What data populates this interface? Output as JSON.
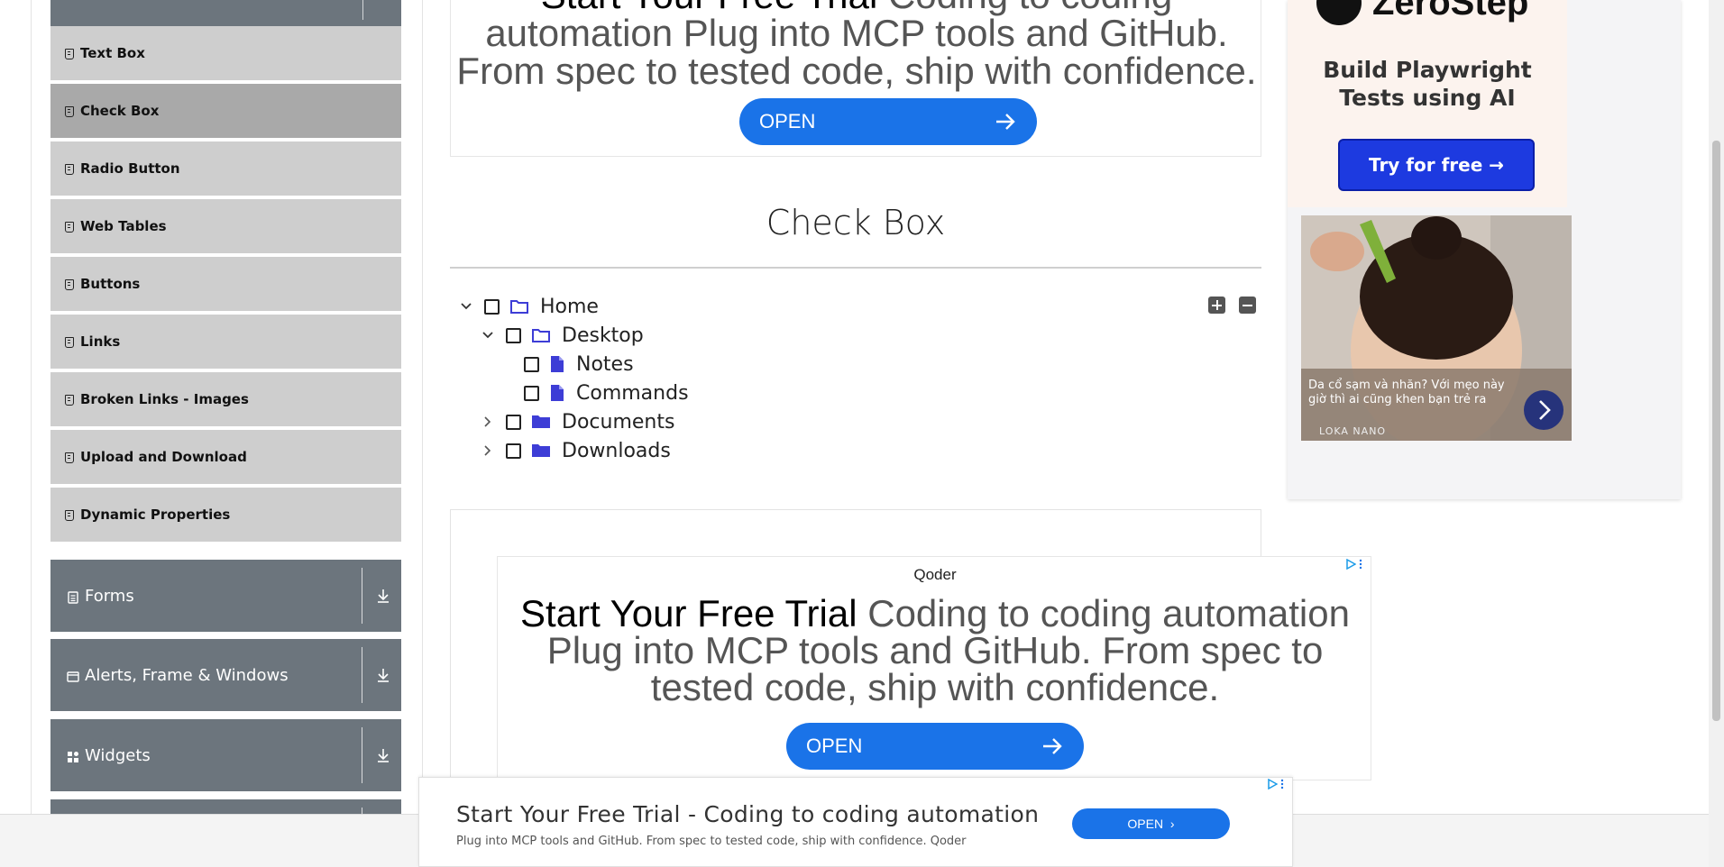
{
  "sidebar": {
    "elements_items": [
      {
        "label": "Text Box"
      },
      {
        "label": "Check Box"
      },
      {
        "label": "Radio Button"
      },
      {
        "label": "Web Tables"
      },
      {
        "label": "Buttons"
      },
      {
        "label": "Links"
      },
      {
        "label": "Broken Links - Images"
      },
      {
        "label": "Upload and Download"
      },
      {
        "label": "Dynamic Properties"
      }
    ],
    "active_item": "Check Box",
    "groups": [
      {
        "label": "Forms",
        "icon": "form-icon"
      },
      {
        "label": "Alerts, Frame & Windows",
        "icon": "window-icon"
      },
      {
        "label": "Widgets",
        "icon": "widgets-icon"
      }
    ]
  },
  "ad_top": {
    "headline_bold": "Start Your Free Trial",
    "headline_rest": " Coding to coding automation Plug into MCP tools and GitHub. From spec to tested code, ship with confidence.",
    "button_label": "OPEN"
  },
  "main": {
    "title": "Check Box",
    "tree": {
      "home": "Home",
      "desktop": "Desktop",
      "notes": "Notes",
      "commands": "Commands",
      "documents": "Documents",
      "downloads": "Downloads"
    }
  },
  "ad_mid": {
    "brand": "Qoder",
    "headline_bold": "Start Your Free Trial",
    "headline_rest": " Coding to coding automation Plug into MCP tools and GitHub. From spec to tested code, ship with confidence.",
    "button_label": "OPEN"
  },
  "ad_bottom": {
    "title": "Start Your Free Trial - Coding to coding automation",
    "subtitle": "Plug into MCP tools and GitHub. From spec to tested code, ship with confidence. Qoder",
    "button_label": "OPEN"
  },
  "ad_right": {
    "logo": "ZeroStep",
    "tagline_1": "Build Playwright",
    "tagline_2": "Tests using AI",
    "cta": "Try for free →",
    "caption": "Da cổ sạm và nhăn? Với mẹo này giờ thì ai cũng khen bạn trẻ ra",
    "source": "LOKA NANO"
  },
  "colors": {
    "group_bg": "#6c757d",
    "item_bg": "#cecece",
    "item_active_bg": "#a9a9a9",
    "ad_blue": "#1a73e8",
    "folder_blue": "#3d3dd6"
  }
}
